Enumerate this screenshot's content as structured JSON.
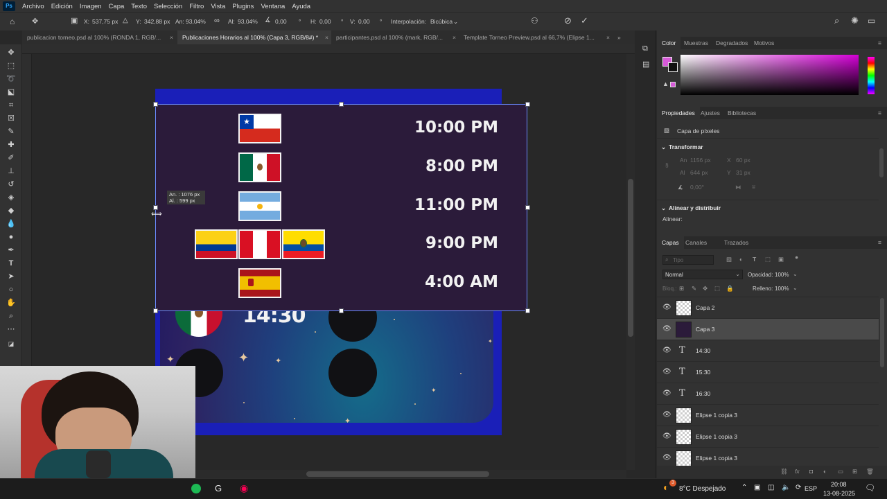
{
  "menu": [
    "Archivo",
    "Edición",
    "Imagen",
    "Capa",
    "Texto",
    "Selección",
    "Filtro",
    "Vista",
    "Plugins",
    "Ventana",
    "Ayuda"
  ],
  "options": {
    "x_label": "X:",
    "x_value": "537,75 px",
    "y_label": "Y:",
    "y_value": "342,88 px",
    "w_label": "An:",
    "w_value": "93,04%",
    "h_label": "Al:",
    "h_value": "93,04%",
    "angle_value": "0,00",
    "hskew_label": "H:",
    "hskew_value": "0,00",
    "vskew_label": "V:",
    "vskew_value": "0,00",
    "interp_label": "Interpolación:",
    "interp_value": "Bicúbica"
  },
  "tabs": [
    "publicacion torneo.psd al 100% (RONDA 1, RGB/...",
    "Publicaciones Horarios al 100% (Capa 3, RGB/8#) *",
    "participantes.psd al 100% (mark, RGB/...",
    "Template Torneo Preview.psd al 66,7% (Elipse 1..."
  ],
  "canvas": {
    "times": [
      "10:00 PM",
      "8:00 PM",
      "11:00 PM",
      "9:00 PM",
      "4:00 AM"
    ],
    "partial_time": "14:30",
    "size_tooltip": {
      "w": "An. :  1076 px",
      "h": "Al. :   599 px"
    }
  },
  "right": {
    "color_tabs": [
      "Color",
      "Muestras",
      "Degradados",
      "Motivos"
    ],
    "props_tabs": [
      "Propiedades",
      "Ajustes",
      "Bibliotecas"
    ],
    "pixel_layer": "Capa de píxeles",
    "transform": "Transformar",
    "transform_fields": {
      "w": "1156 px",
      "x": "60 px",
      "h": "644 px",
      "y": "31 px",
      "angle": "0,00°"
    },
    "align": "Alinear y distribuir",
    "align_label": "Alinear:",
    "layers_tabs": [
      "Capas",
      "Canales",
      "Trazados"
    ],
    "filter_placeholder": "Tipo",
    "blend_mode": "Normal",
    "opacity_label": "Opacidad:",
    "opacity_value": "100%",
    "lock_label": "Bloq.:",
    "fill_label": "Relleno:",
    "fill_value": "100%",
    "layers": [
      {
        "name": "Capa 2",
        "kind": "pixel"
      },
      {
        "name": "Capa 3",
        "kind": "pixel",
        "selected": true
      },
      {
        "name": "14:30",
        "kind": "text"
      },
      {
        "name": "15:30",
        "kind": "text"
      },
      {
        "name": "16:30",
        "kind": "text"
      },
      {
        "name": "Elipse 1 copia 3",
        "kind": "shape"
      },
      {
        "name": "Elipse 1 copia 3",
        "kind": "shape"
      },
      {
        "name": "Elipse 1 copia 3",
        "kind": "shape"
      }
    ]
  },
  "taskbar": {
    "weather": "8°C  Despejado",
    "lang": "ESP",
    "time": "20:08",
    "date": "13-08-2025",
    "notif_count": "3"
  },
  "colors": {
    "fg_swatch": "#d65ad8",
    "accent": "#31a8ff",
    "canvas_border": "#1a1fb8"
  }
}
